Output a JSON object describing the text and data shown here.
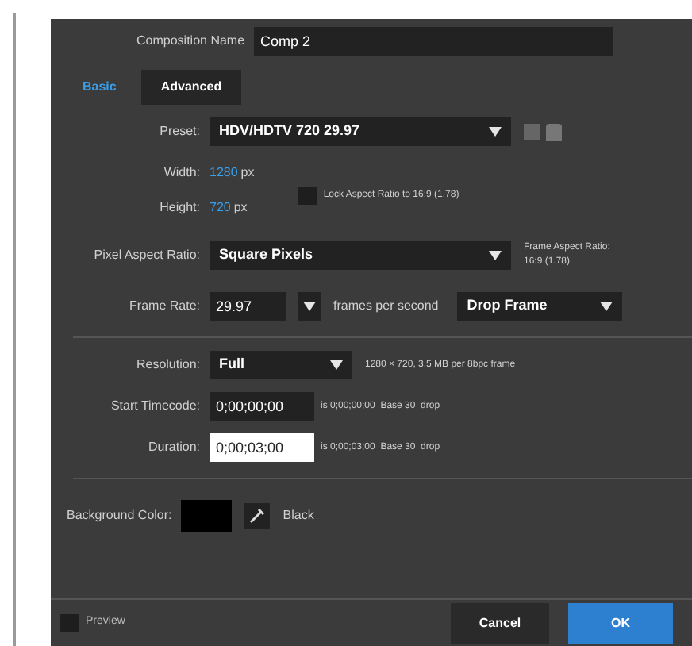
{
  "composition_name": {
    "label": "Composition Name",
    "value": "Comp 2"
  },
  "tabs": [
    {
      "label": "Basic",
      "selected": true
    },
    {
      "label": "Advanced",
      "selected": false
    }
  ],
  "preset": {
    "label": "Preset:",
    "value": "HDV/HDTV 720 29.97"
  },
  "width": {
    "label": "Width:",
    "value": "1280",
    "unit": "px"
  },
  "height": {
    "label": "Height:",
    "value": "720",
    "unit": "px"
  },
  "lock_aspect": {
    "label": "Lock Aspect Ratio to 16:9 (1.78)",
    "checked": false
  },
  "pixel_aspect": {
    "label": "Pixel Aspect Ratio:",
    "value": "Square Pixels",
    "note_title": "Frame Aspect Ratio:",
    "note_value": "16:9 (1.78)"
  },
  "frame_rate": {
    "label": "Frame Rate:",
    "value": "29.97",
    "unit": "frames per second",
    "mode": "Drop Frame"
  },
  "resolution": {
    "label": "Resolution:",
    "value": "Full",
    "info": "1280 × 720, 3.5 MB per 8bpc frame"
  },
  "start_timecode": {
    "label": "Start Timecode:",
    "value": "0;00;00;00",
    "info": "is 0;00;00;00  Base 30  drop"
  },
  "duration": {
    "label": "Duration:",
    "value": "0;00;03;00",
    "info": "is 0;00;03;00  Base 30  drop"
  },
  "background": {
    "label": "Background Color:",
    "color": "#000000",
    "name": "Black"
  },
  "preview": {
    "label": "Preview",
    "checked": false
  },
  "buttons": [
    "Cancel",
    "OK"
  ]
}
